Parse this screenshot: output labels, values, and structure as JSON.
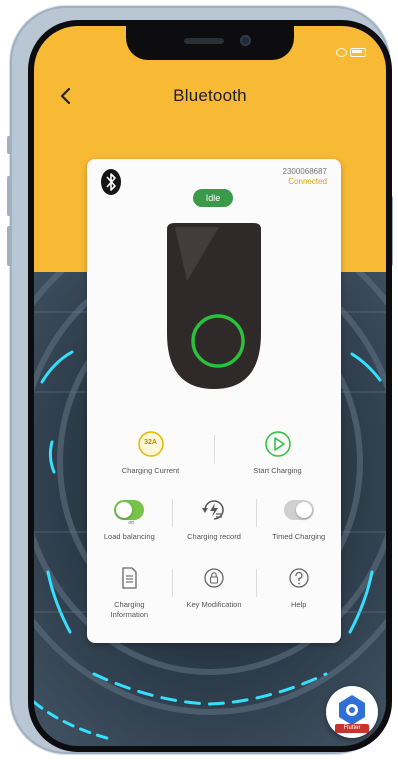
{
  "header": {
    "title": "Bluetooth"
  },
  "device": {
    "id": "2300068687",
    "status": "Connected",
    "state_badge": "Idle"
  },
  "actions": {
    "charging_current": {
      "badge": "32A",
      "label": "Charging Current"
    },
    "start_charging": {
      "label": "Start Charging"
    },
    "load_balancing": {
      "label": "Load balancing",
      "toggle_text": "on",
      "enabled": true
    },
    "charging_record": {
      "label": "Charging record"
    },
    "timed_charging": {
      "label": "Timed Charging",
      "enabled": false
    },
    "charging_information": {
      "label": "Charging\nInformation"
    },
    "key_modification": {
      "label": "Key Modification"
    },
    "help": {
      "label": "Help"
    }
  },
  "fab": {
    "label": "Flutter"
  },
  "colors": {
    "header_bg": "#f8b934",
    "accent_green": "#3a9a4a",
    "ring_green": "#29c23a",
    "badge_yellow": "#e6b800"
  }
}
